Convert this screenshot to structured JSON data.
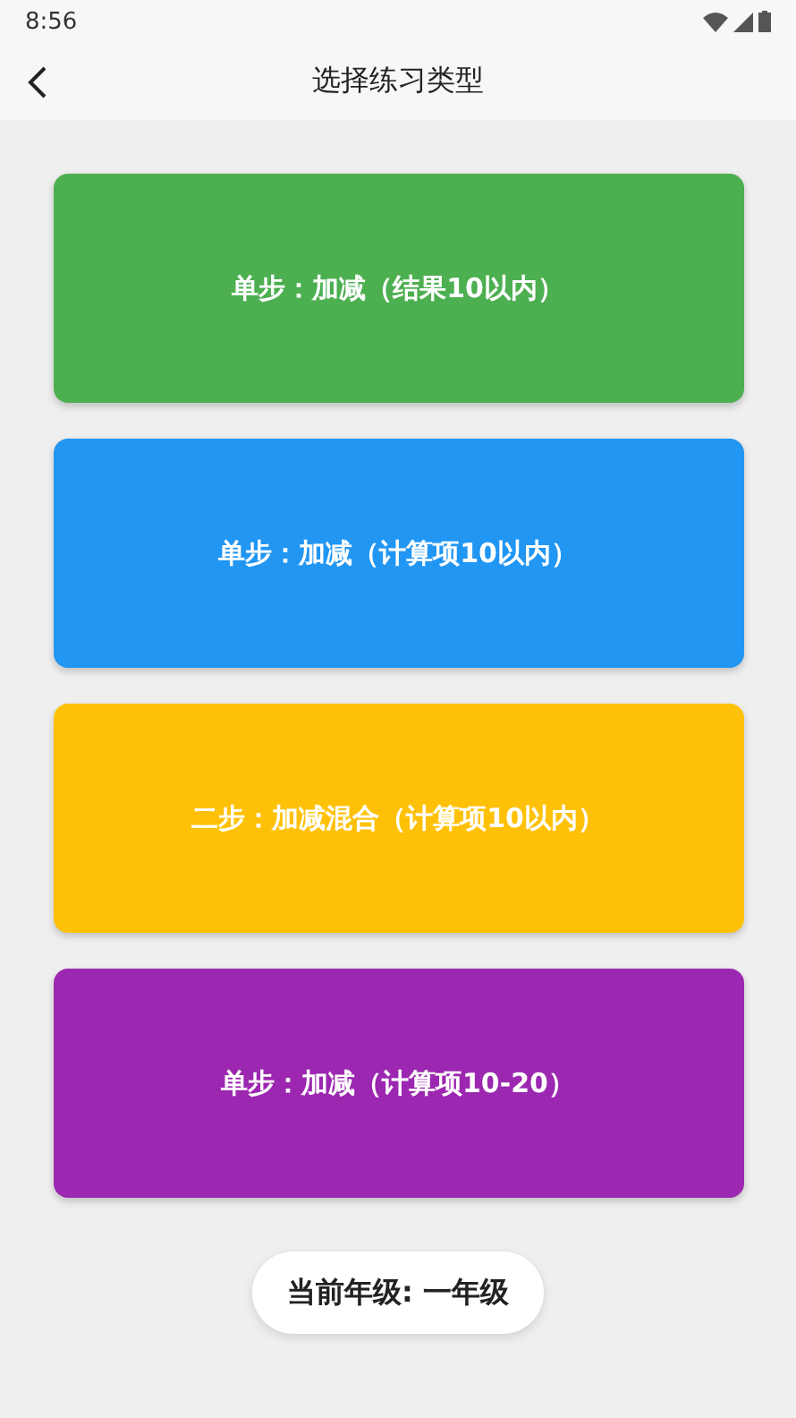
{
  "status_bar": {
    "time": "8:56"
  },
  "app_bar": {
    "title": "选择练习类型"
  },
  "options": [
    {
      "label": "单步：加减（结果10以内）",
      "color": "#4caf50"
    },
    {
      "label": "单步：加减（计算项10以内）",
      "color": "#2196f3"
    },
    {
      "label": "二步：加减混合（计算项10以内）",
      "color": "#ffc107"
    },
    {
      "label": "单步：加减（计算项10-20）",
      "color": "#9c27b0"
    }
  ],
  "grade_button": {
    "label": "当前年级: 一年级"
  }
}
